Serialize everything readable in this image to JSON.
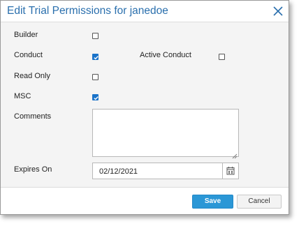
{
  "dialog": {
    "title": "Edit Trial Permissions for janedoe",
    "close_icon": "close-icon"
  },
  "fields": {
    "builder": {
      "label": "Builder",
      "checked": false
    },
    "conduct": {
      "label": "Conduct",
      "checked": true
    },
    "active_conduct": {
      "label": "Active Conduct",
      "checked": false
    },
    "read_only": {
      "label": "Read Only",
      "checked": false
    },
    "msc": {
      "label": "MSC",
      "checked": true
    },
    "comments": {
      "label": "Comments",
      "value": ""
    },
    "expires_on": {
      "label": "Expires On",
      "value": "02/12/2021",
      "icon": "calendar-icon"
    }
  },
  "footer": {
    "save_label": "Save",
    "cancel_label": "Cancel"
  },
  "colors": {
    "title": "#2a6fad",
    "accent": "#2b97d6",
    "checkbox_checked": "#1a73c9"
  }
}
